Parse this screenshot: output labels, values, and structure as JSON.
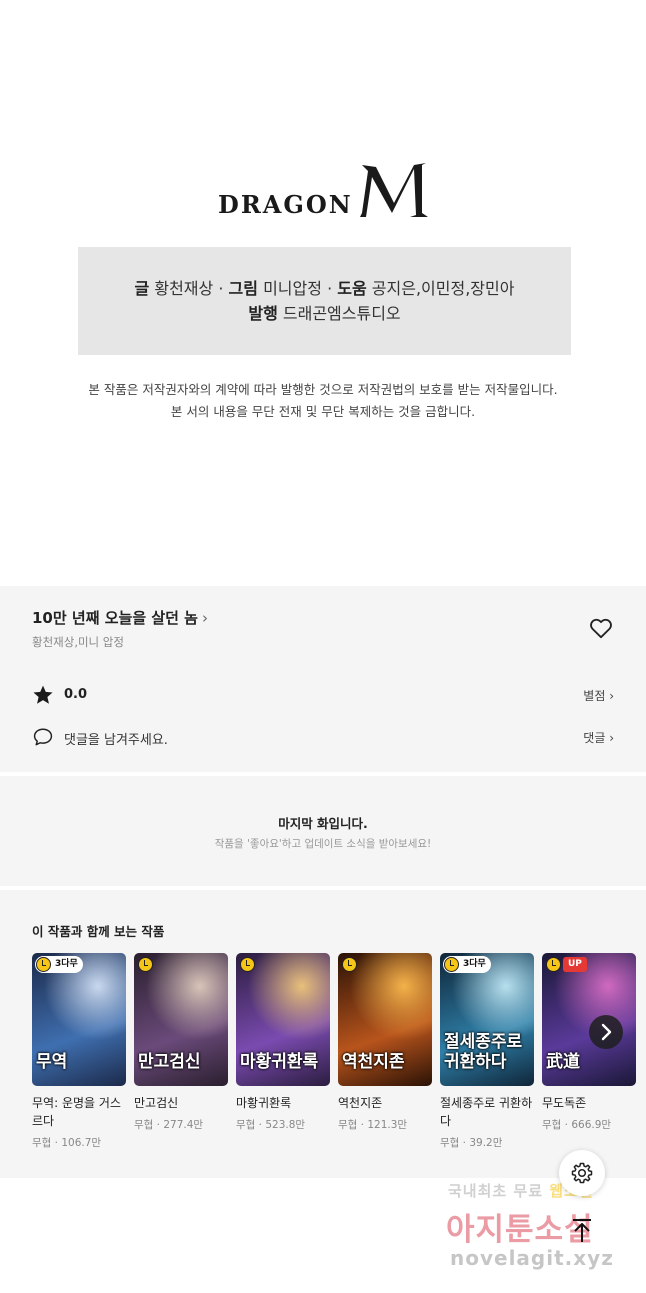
{
  "credits": {
    "logo_text": "DRAGON",
    "logo_mark": "M",
    "line1": [
      {
        "label": "글",
        "value": "황천재상"
      },
      {
        "label": "그림",
        "value": "미니압정"
      },
      {
        "label": "도움",
        "value": "공지은,이민정,장민아"
      }
    ],
    "line2": {
      "label": "발행",
      "value": "드래곤엠스튜디오"
    },
    "separator": "·",
    "copyright_1": "본 작품은 저작권자와의 계약에 따라 발행한 것으로 저작권법의 보호를 받는 저작물입니다.",
    "copyright_2": "본 서의 내용을 무단 전재 및 무단 복제하는 것을 금합니다."
  },
  "series": {
    "title": "10만 년째 오늘을 살던 놈",
    "title_chevron": "›",
    "author": "황천재상,미니 압정",
    "rating": "0.0",
    "rate_link": "별점 ›",
    "comment_prompt": "댓글을 남겨주세요.",
    "comment_link": "댓글 ›"
  },
  "last_episode": {
    "title": "마지막 화입니다.",
    "subtitle": "작품을 '좋아요'하고 업데이트 소식을 받아보세요!"
  },
  "recommendations": {
    "heading": "이 작품과 함께 보는 작품",
    "items": [
      {
        "title": "무역: 운명을 거스르다",
        "cover_text": "무역",
        "genre": "무협",
        "views": "106.7만",
        "badge": "3다무",
        "colors": [
          "#1c2a4a",
          "#3f6fb0",
          "#c9d8ee"
        ]
      },
      {
        "title": "만고검신",
        "cover_text": "만고검신",
        "genre": "무협",
        "views": "277.4만",
        "badge": "",
        "colors": [
          "#2a1f2e",
          "#6a4a7a",
          "#d8c4b8"
        ]
      },
      {
        "title": "마황귀환록",
        "cover_text": "마황귀환록",
        "genre": "무협",
        "views": "523.8만",
        "badge": "",
        "colors": [
          "#2b1d3f",
          "#7a4bb0",
          "#e8c07a"
        ]
      },
      {
        "title": "역천지존",
        "cover_text": "역천지존",
        "genre": "무협",
        "views": "121.3만",
        "badge": "",
        "colors": [
          "#2a1206",
          "#b8541c",
          "#f4b24a"
        ]
      },
      {
        "title": "절세종주로 귀환하다",
        "cover_text": "절세종주로 귀환하다",
        "genre": "무협",
        "views": "39.2만",
        "badge": "3다무",
        "colors": [
          "#0f2538",
          "#2f7fa8",
          "#b7e0ee"
        ]
      },
      {
        "title": "무도독존",
        "cover_text": "武道",
        "genre": "무협",
        "views": "666.9만",
        "badge": "UP",
        "colors": [
          "#1a1836",
          "#5a3a9a",
          "#d06ac0"
        ]
      }
    ],
    "meta_separator": "·"
  },
  "watermark": {
    "line1_a": "국내최초 무료 ",
    "line1_b": "웹소설",
    "line2": "아지툰소설",
    "line3": "novelagit.xyz"
  },
  "icons": {
    "heart": "heart-icon",
    "star": "star-icon",
    "comment": "speech-bubble-icon",
    "next": "chevron-right-icon",
    "settings": "gear-icon",
    "scroll_top": "arrow-up-icon"
  }
}
